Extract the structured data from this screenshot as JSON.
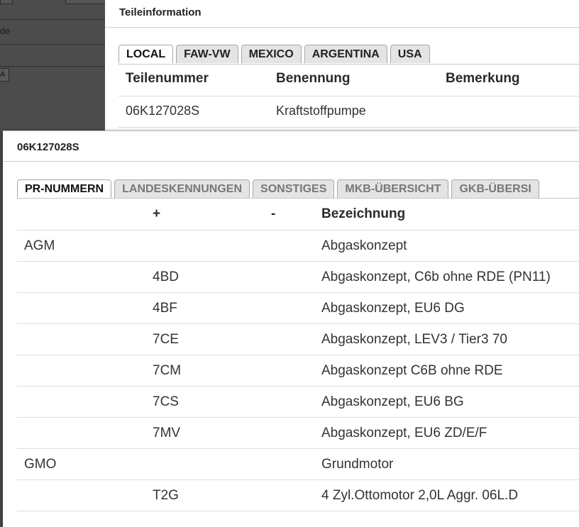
{
  "background_panel": {
    "partial_label": "de",
    "partial_input_value": "A"
  },
  "parts_window": {
    "title": "Teileinformation",
    "tabs": [
      "LOCAL",
      "FAW-VW",
      "MEXICO",
      "ARGENTINA",
      "USA"
    ],
    "active_tab": "LOCAL",
    "columns": [
      "Teilenummer",
      "Benennung",
      "Bemerkung"
    ],
    "rows": [
      {
        "teilenummer": "06K127028S",
        "benennung": "Kraftstoffpumpe",
        "bemerkung": ""
      }
    ]
  },
  "detail_window": {
    "title": "06K127028S",
    "tabs": [
      "PR-NUMMERN",
      "LANDESKENNUNGEN",
      "SONSTIGES",
      "MKB-ÜBERSICHT",
      "GKB-ÜBERSI"
    ],
    "active_tab": "PR-NUMMERN",
    "columns": {
      "group": "",
      "plus": "+",
      "minus": "-",
      "description": "Bezeichnung"
    },
    "rows": [
      {
        "group": "AGM",
        "plus": "",
        "description": "Abgaskonzept"
      },
      {
        "group": "",
        "plus": "4BD",
        "description": "Abgaskonzept, C6b ohne RDE (PN11)"
      },
      {
        "group": "",
        "plus": "4BF",
        "description": "Abgaskonzept, EU6 DG"
      },
      {
        "group": "",
        "plus": "7CE",
        "description": "Abgaskonzept, LEV3 / Tier3 70"
      },
      {
        "group": "",
        "plus": "7CM",
        "description": "Abgaskonzept C6B ohne RDE"
      },
      {
        "group": "",
        "plus": "7CS",
        "description": "Abgaskonzept, EU6 BG"
      },
      {
        "group": "",
        "plus": "7MV",
        "description": "Abgaskonzept, EU6 ZD/E/F"
      },
      {
        "group": "GMO",
        "plus": "",
        "description": "Grundmotor"
      },
      {
        "group": "",
        "plus": "T2G",
        "description": "4 Zyl.Ottomotor 2,0L Aggr. 06L.D"
      }
    ]
  },
  "colors": {
    "overlay": "#4a4a4a",
    "window": "#ffffff",
    "tab_inactive": "#e4e4e4",
    "border": "#c7c7c7"
  }
}
